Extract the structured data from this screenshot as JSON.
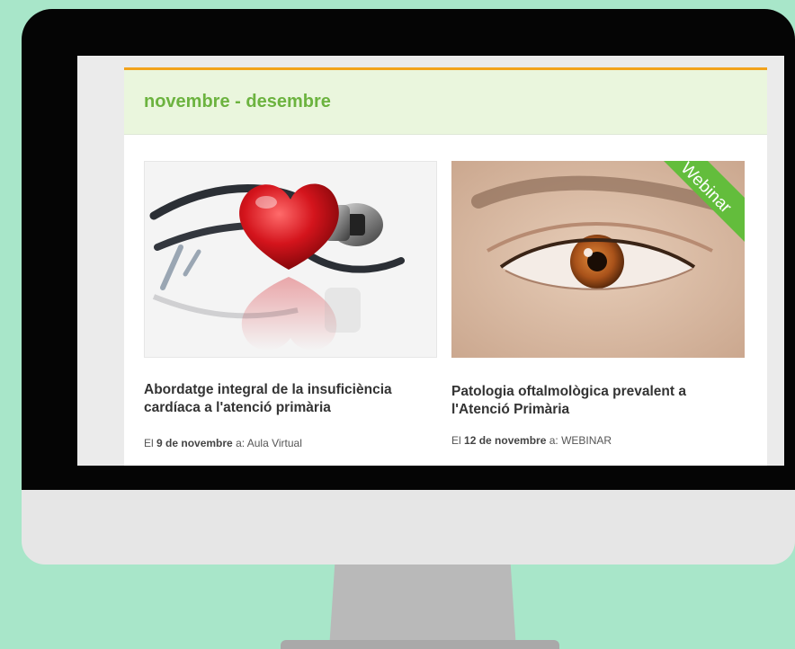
{
  "section": {
    "title": "novembre - desembre"
  },
  "courses": [
    {
      "title": "Abordatge integral de la insuficiència cardíaca a l'atenció primària",
      "date_prefix": "El",
      "date": "9 de novembre",
      "location_prefix": "a:",
      "location": "Aula Virtual",
      "image": "heart-stethoscope"
    },
    {
      "title": "Patologia oftalmològica prevalent a l'Atenció Primària",
      "date_prefix": "El",
      "date": "12 de novembre",
      "location_prefix": "a:",
      "location": "WEBINAR",
      "image": "eye",
      "badge": "Webinar"
    }
  ],
  "colors": {
    "background": "#a8e6c9",
    "header_accent": "#f2a31c",
    "title_green": "#6cb33f",
    "ribbon_green": "#63bd3c"
  }
}
